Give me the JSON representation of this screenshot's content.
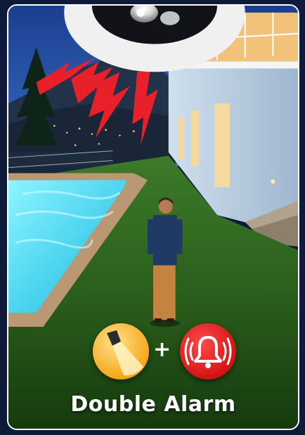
{
  "caption": "Double Alarm",
  "separator": "+",
  "icons": {
    "left": "flashlight-icon",
    "right": "alarm-bell-icon"
  },
  "colors": {
    "flash_icon": "#f5a81c",
    "alarm_icon": "#d41414",
    "lightning": "#e8202a"
  }
}
